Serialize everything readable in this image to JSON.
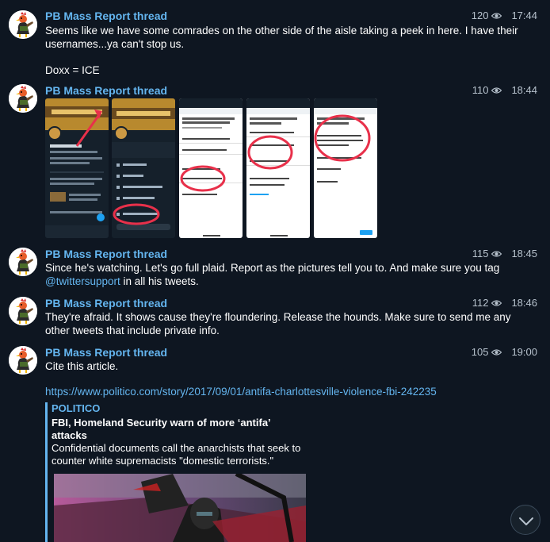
{
  "messages": [
    {
      "author": "PB Mass Report thread",
      "views": "120",
      "time": "17:44",
      "text": "Seems like we have some comrades on the other side of the aisle taking a peek in here. I have their usernames...ya can't stop us.\n\nDoxx = ICE"
    },
    {
      "author": "PB Mass Report thread",
      "views": "110",
      "time": "18:44"
    },
    {
      "author": "PB Mass Report thread",
      "views": "115",
      "time": "18:45",
      "text_before": "Since he's watching. Let's go full plaid. Report as the pictures tell you to. And make sure you tag ",
      "mention": "@twittersupport",
      "text_after": " in all his tweets."
    },
    {
      "author": "PB Mass Report thread",
      "views": "112",
      "time": "18:46",
      "text": "They're afraid. It shows cause they're floundering. Release the hounds. Make sure to send me any other tweets that include private info."
    },
    {
      "author": "PB Mass Report thread",
      "views": "105",
      "time": "19:00",
      "text": "Cite this article.",
      "url": "https://www.politico.com/story/2017/09/01/antifa-charlottesville-violence-fbi-242235"
    }
  ],
  "link_preview": {
    "site": "POLITICO",
    "title": "FBI, Homeland Security warn of more ‘antifa’ attacks",
    "description": "Confidential documents call the anarchists that seek to counter white supremacists \"domestic terrorists.\""
  },
  "icons": {
    "views": "eye-icon",
    "scroll": "chevron-down-icon",
    "avatar": "rooster-avatar"
  },
  "colors": {
    "background": "#0e1621",
    "author": "#64b5ef",
    "link": "#64b5ef",
    "meta": "#b7c2cd",
    "annotation_red": "#e8304a"
  }
}
